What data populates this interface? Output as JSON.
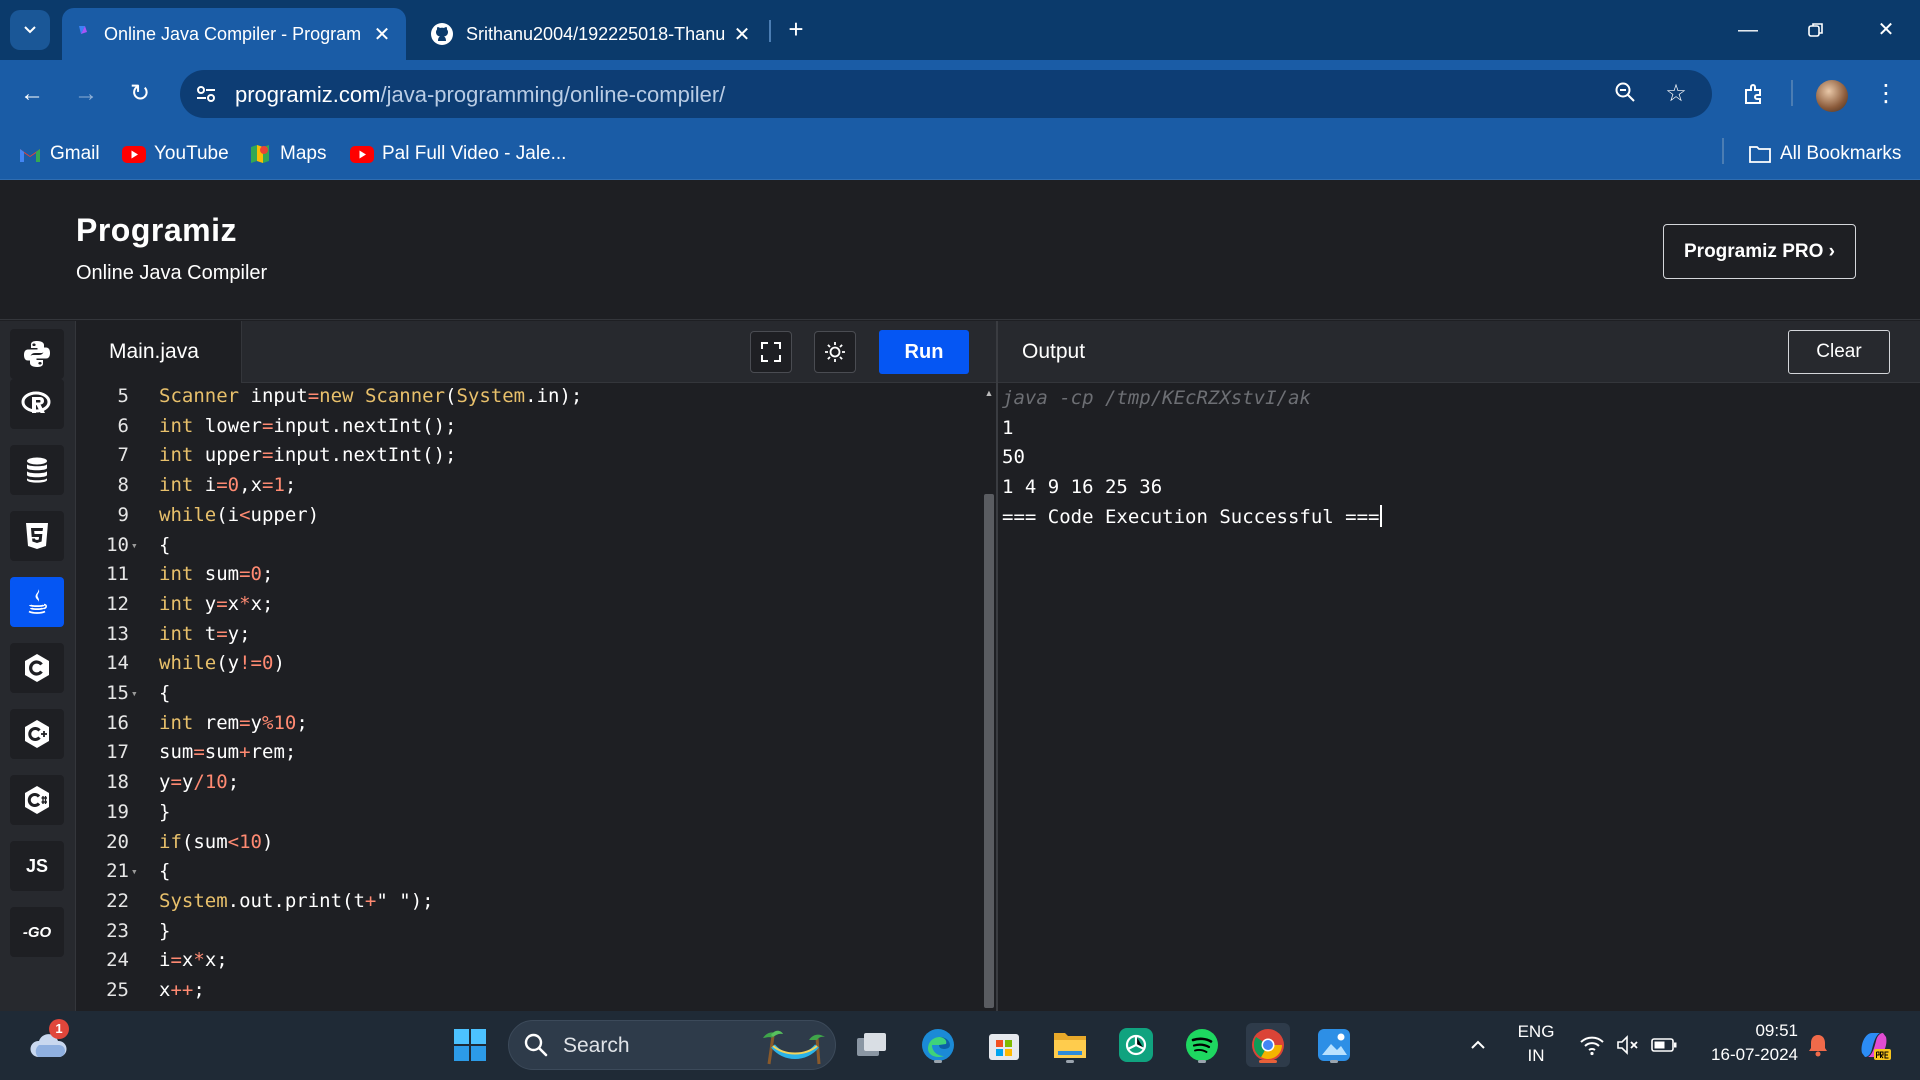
{
  "browser": {
    "tabs": [
      {
        "title": "Online Java Compiler - Program",
        "active": true
      },
      {
        "title": "Srithanu2004/192225018-Thanu",
        "active": false
      }
    ],
    "url_host": "programiz.com",
    "url_path": "/java-programming/online-compiler/",
    "bookmarks": [
      {
        "label": "Gmail",
        "icon": "gmail-icon"
      },
      {
        "label": "YouTube",
        "icon": "youtube-icon"
      },
      {
        "label": "Maps",
        "icon": "maps-icon"
      },
      {
        "label": "Pal Full Video - Jale...",
        "icon": "youtube-icon"
      }
    ],
    "all_bookmarks": "All Bookmarks"
  },
  "site": {
    "logo": "Programiz",
    "subtitle": "Online Java Compiler",
    "pro_button": "Programiz PRO ›"
  },
  "languages": [
    {
      "name": "python-icon",
      "active": false
    },
    {
      "name": "r-icon",
      "active": false
    },
    {
      "name": "sql-icon",
      "active": false
    },
    {
      "name": "html-icon",
      "active": false
    },
    {
      "name": "java-icon",
      "active": true
    },
    {
      "name": "c-icon",
      "active": false
    },
    {
      "name": "cpp-icon",
      "active": false
    },
    {
      "name": "csharp-icon",
      "active": false
    },
    {
      "name": "javascript-icon",
      "label": "JS",
      "active": false
    },
    {
      "name": "go-icon",
      "label": "-GO",
      "active": false
    }
  ],
  "editor": {
    "file_name": "Main.java",
    "run_label": "Run",
    "lines": [
      {
        "n": "5",
        "fold": false,
        "code": "Scanner input=new Scanner(System.in);"
      },
      {
        "n": "6",
        "fold": false,
        "code": "int lower=input.nextInt();"
      },
      {
        "n": "7",
        "fold": false,
        "code": "int upper=input.nextInt();"
      },
      {
        "n": "8",
        "fold": false,
        "code": "int i=0,x=1;"
      },
      {
        "n": "9",
        "fold": false,
        "code": "while(i<upper)"
      },
      {
        "n": "10",
        "fold": true,
        "code": "{"
      },
      {
        "n": "11",
        "fold": false,
        "code": "int sum=0;"
      },
      {
        "n": "12",
        "fold": false,
        "code": "int y=x*x;"
      },
      {
        "n": "13",
        "fold": false,
        "code": "int t=y;"
      },
      {
        "n": "14",
        "fold": false,
        "code": "while(y!=0)"
      },
      {
        "n": "15",
        "fold": true,
        "code": "{"
      },
      {
        "n": "16",
        "fold": false,
        "code": "int rem=y%10;"
      },
      {
        "n": "17",
        "fold": false,
        "code": "sum=sum+rem;"
      },
      {
        "n": "18",
        "fold": false,
        "code": "y=y/10;"
      },
      {
        "n": "19",
        "fold": false,
        "code": "}"
      },
      {
        "n": "20",
        "fold": false,
        "code": "if(sum<10)"
      },
      {
        "n": "21",
        "fold": true,
        "code": "{"
      },
      {
        "n": "22",
        "fold": false,
        "code": "System.out.print(t+\" \");"
      },
      {
        "n": "23",
        "fold": false,
        "code": "}"
      },
      {
        "n": "24",
        "fold": false,
        "code": "i=x*x;"
      },
      {
        "n": "25",
        "fold": false,
        "code": "x++;"
      }
    ]
  },
  "output": {
    "title": "Output",
    "clear_label": "Clear",
    "command": "java -cp /tmp/KEcRZXstvI/ak",
    "lines": [
      "1",
      "50",
      "1 4 9 16 25 36",
      "=== Code Execution Successful ==="
    ]
  },
  "taskbar": {
    "weather_badge": "1",
    "search_placeholder": "Search",
    "lang_top": "ENG",
    "lang_bottom": "IN",
    "time": "09:51",
    "date": "16-07-2024"
  },
  "colors": {
    "accent": "#0556f3",
    "browser_bar": "#1a5ca6",
    "tab_strip": "#0b3a6b",
    "page_bg": "#1e1f23"
  }
}
